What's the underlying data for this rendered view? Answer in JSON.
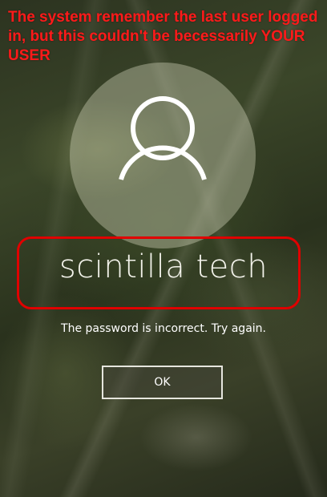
{
  "annotation": {
    "text": "The system remember the last user logged in, but this couldn't be becessarily YOUR USER"
  },
  "user": {
    "name": "scintilla tech"
  },
  "login": {
    "error_message": "The password is incorrect. Try again.",
    "ok_label": "OK"
  },
  "icons": {
    "avatar": "user-silhouette-icon"
  },
  "colors": {
    "annotation": "#ff1a1a",
    "highlight_border": "#e00000",
    "text": "#ffffff"
  }
}
